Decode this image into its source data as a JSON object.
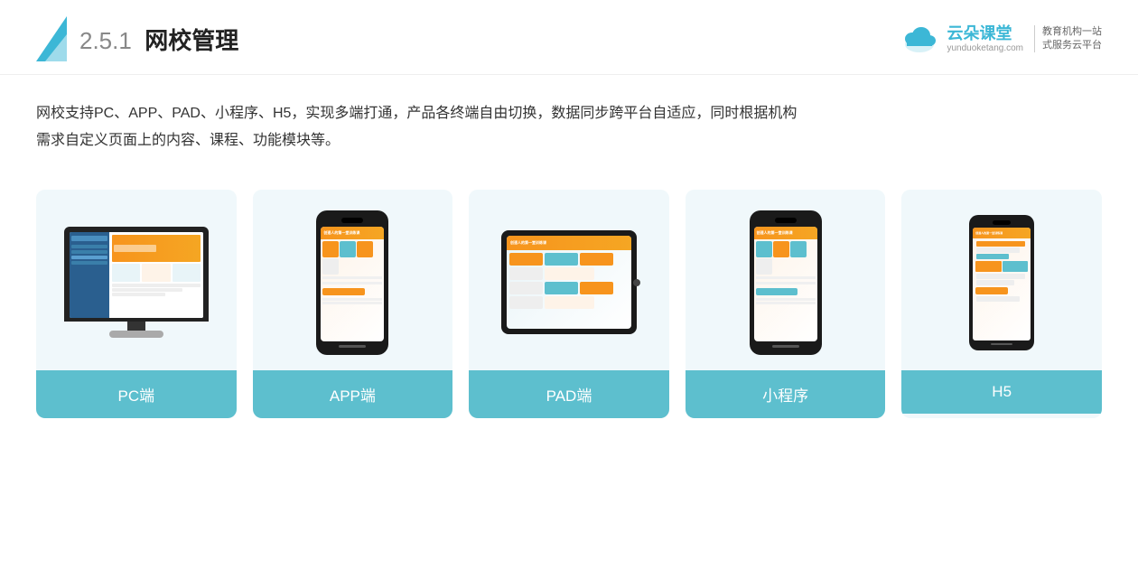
{
  "header": {
    "section_num": "2.5.1",
    "title": "网校管理",
    "logo_name": "云朵课堂",
    "logo_url": "yunduoketang.com",
    "logo_slogan_line1": "教育机构一站",
    "logo_slogan_line2": "式服务云平台"
  },
  "description": {
    "text_line1": "网校支持PC、APP、PAD、小程序、H5，实现多端打通，产品各终端自由切换，数据同步跨平台自适应，同时根据机构",
    "text_line2": "需求自定义页面上的内容、课程、功能模块等。"
  },
  "cards": [
    {
      "id": "pc",
      "label": "PC端"
    },
    {
      "id": "app",
      "label": "APP端"
    },
    {
      "id": "pad",
      "label": "PAD端"
    },
    {
      "id": "miniprogram",
      "label": "小程序"
    },
    {
      "id": "h5",
      "label": "H5"
    }
  ],
  "colors": {
    "teal": "#5dbfce",
    "teal_light": "#f0f8fb",
    "orange": "#f7941d",
    "blue_dark": "#2a5f8f",
    "text_dark": "#333",
    "header_title_num": "#666"
  }
}
